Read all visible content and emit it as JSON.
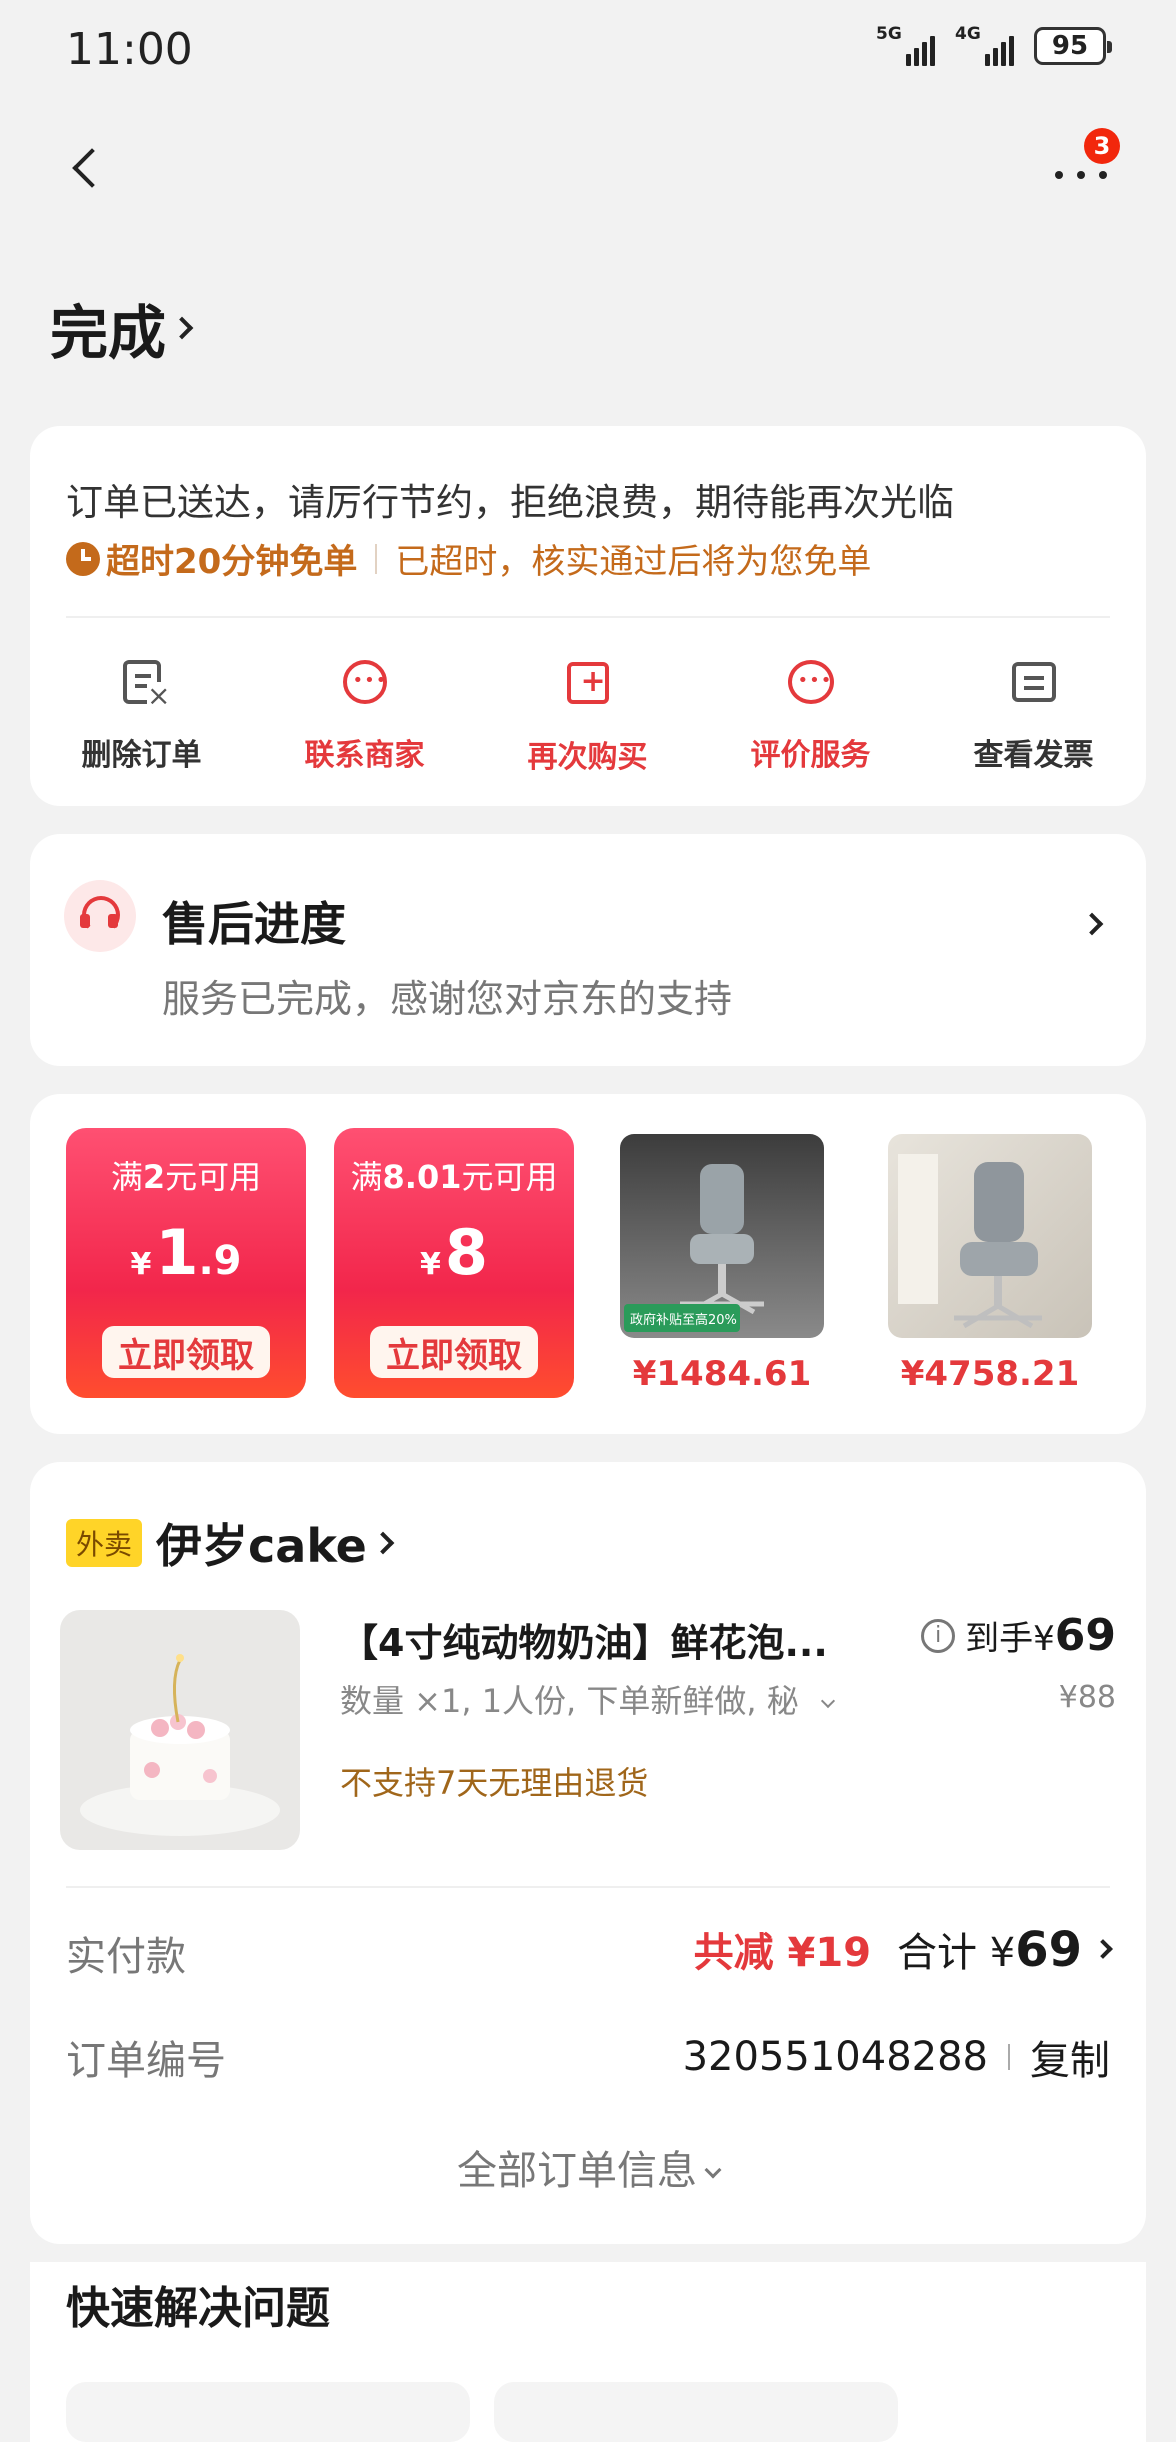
{
  "status_bar": {
    "time": "11:00",
    "net1": "5G",
    "net2": "4G",
    "battery": "95"
  },
  "nav": {
    "more_badge": "3"
  },
  "header": {
    "title": "完成"
  },
  "order_status": {
    "message": "订单已送达，请厉行节约，拒绝浪费，期待能再次光临",
    "timeout_label": "超时20分钟免单",
    "timeout_note": "已超时，核实通过后将为您免单",
    "actions": [
      {
        "label": "删除订单",
        "icon": "delete-order-icon",
        "color": "#333333"
      },
      {
        "label": "联系商家",
        "icon": "contact-merchant-icon",
        "color": "#e4393c"
      },
      {
        "label": "再次购买",
        "icon": "buy-again-icon",
        "color": "#e4393c"
      },
      {
        "label": "评价服务",
        "icon": "review-icon",
        "color": "#e4393c"
      },
      {
        "label": "查看发票",
        "icon": "invoice-icon",
        "color": "#333333"
      }
    ]
  },
  "after_sale": {
    "title": "售后进度",
    "desc": "服务已完成，感谢您对京东的支持"
  },
  "promo": {
    "coupons": [
      {
        "condition_pre": "满",
        "condition_amount": "2",
        "condition_post": "元可用",
        "amount_int": "1",
        "amount_dec": ".9",
        "button": "立即领取"
      },
      {
        "condition_pre": "满",
        "condition_amount": "8.01",
        "condition_post": "元可用",
        "amount_int": "8",
        "amount_dec": "",
        "button": "立即领取"
      }
    ],
    "products": [
      {
        "price": "¥1484.61",
        "badge": "政府补贴至高20%"
      },
      {
        "price": "¥4758.21"
      }
    ]
  },
  "order": {
    "shop_tag": "外卖",
    "shop_name": "伊岁cake",
    "item_title": "【4寸纯动物奶油】鲜花泡...",
    "item_final_label": "到手¥",
    "item_final_price": "69",
    "item_spec": "数量 ×1, 1人份, 下单新鲜做, 秘",
    "item_orig_price": "¥88",
    "item_policy": "不支持7天无理由退货",
    "pay_label": "实付款",
    "pay_discount": "共减 ¥19",
    "pay_total_label": "合计 ¥",
    "pay_total": "69",
    "order_id_label": "订单编号",
    "order_id": "320551048288",
    "copy_label": "复制",
    "all_info": "全部订单信息"
  },
  "quick": {
    "title": "快速解决问题"
  }
}
